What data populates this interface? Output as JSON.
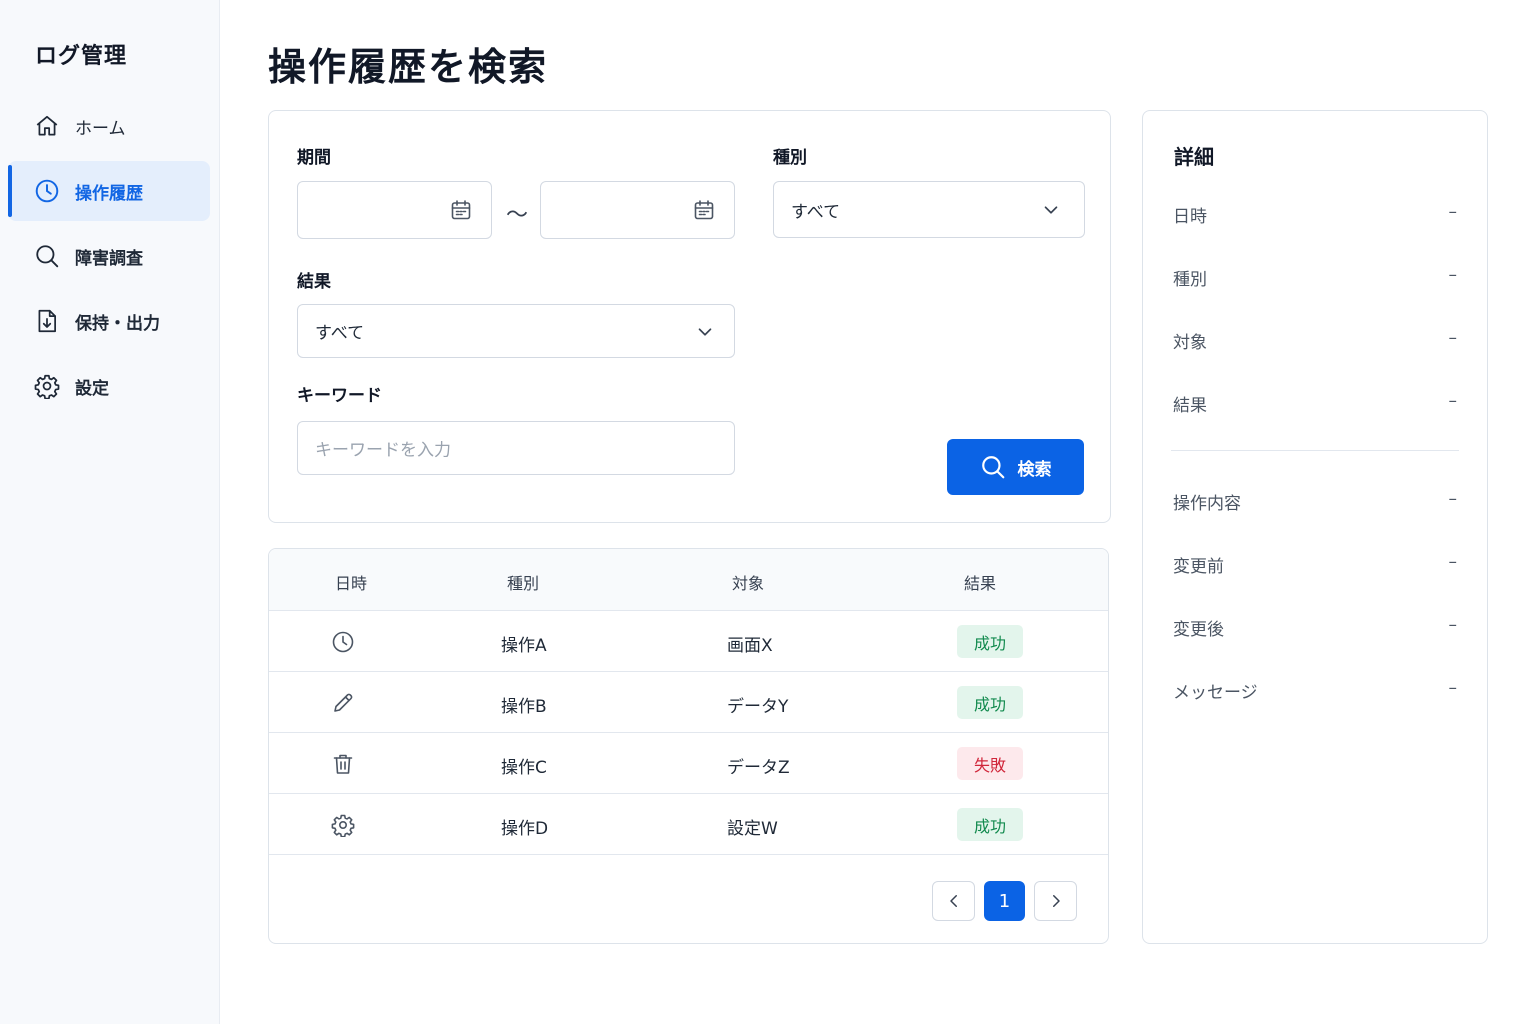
{
  "sidebar": {
    "app_title": "ログ管理",
    "items": [
      {
        "label": "ホーム",
        "icon": "home-icon"
      },
      {
        "label": "操作履歴",
        "icon": "clock-icon"
      },
      {
        "label": "障害調査",
        "icon": "search-icon"
      },
      {
        "label": "保持・出力",
        "icon": "file-download-icon"
      },
      {
        "label": "設定",
        "icon": "gear-icon"
      }
    ],
    "active_index": 1
  },
  "header": {
    "title": "操作履歴を検索"
  },
  "search": {
    "period_label": "期間",
    "period_separator": "〜",
    "type_label": "種別",
    "type_value": "すべて",
    "result_label": "結果",
    "result_value": "すべて",
    "keyword_label": "キーワード",
    "keyword_placeholder": "キーワードを入力",
    "button_label": "検索"
  },
  "table": {
    "columns": [
      "日時",
      "種別",
      "対象",
      "結果"
    ],
    "rows": [
      {
        "icon": "clock-icon",
        "type": "操作A",
        "target": "画面X",
        "result": "成功",
        "status": "success"
      },
      {
        "icon": "pencil-icon",
        "type": "操作B",
        "target": "データY",
        "result": "成功",
        "status": "success"
      },
      {
        "icon": "trash-icon",
        "type": "操作C",
        "target": "データZ",
        "result": "失敗",
        "status": "failure"
      },
      {
        "icon": "gear-icon",
        "type": "操作D",
        "target": "設定W",
        "result": "成功",
        "status": "success"
      }
    ],
    "pagination": {
      "current_page": "1"
    }
  },
  "detail": {
    "title": "詳細",
    "fields": [
      {
        "label": "日時",
        "value": "–"
      },
      {
        "label": "種別",
        "value": "–"
      },
      {
        "label": "対象",
        "value": "–"
      },
      {
        "label": "結果",
        "value": "–"
      },
      {
        "label": "操作内容",
        "value": "–"
      },
      {
        "label": "変更前",
        "value": "–"
      },
      {
        "label": "変更後",
        "value": "–"
      },
      {
        "label": "メッセージ",
        "value": "–"
      }
    ]
  },
  "colors": {
    "accent": "#0b63e5",
    "active_bg": "#e4eefc",
    "success_bg": "#e3f5ec",
    "success_text": "#128a4e",
    "failure_bg": "#fde9ec",
    "failure_text": "#d0263a"
  }
}
